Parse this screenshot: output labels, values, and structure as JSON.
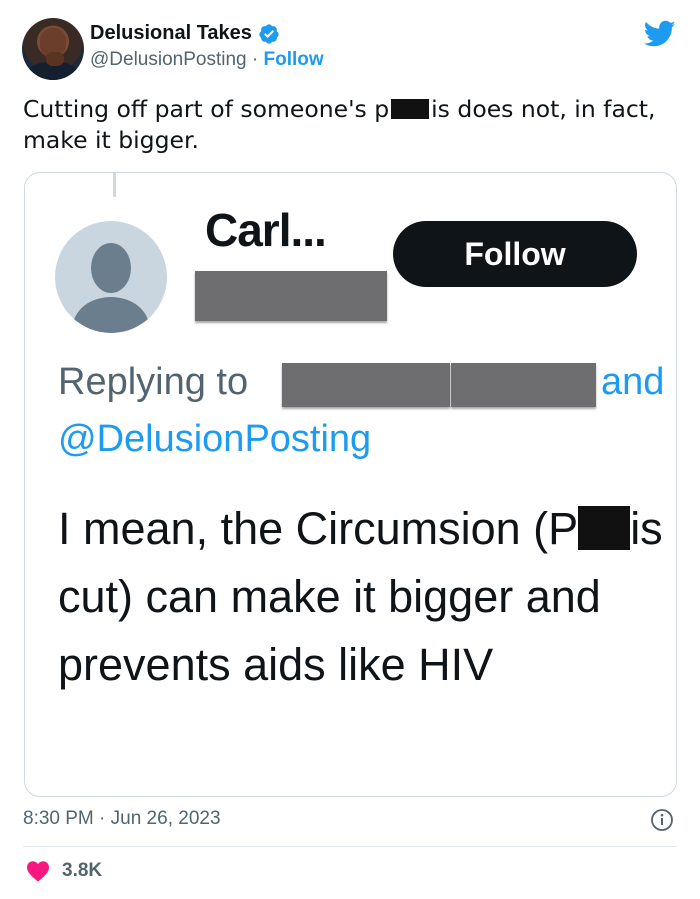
{
  "author": {
    "name": "Delusional Takes",
    "handle": "@DelusionPosting",
    "separator": " · ",
    "follow_label": "Follow"
  },
  "tweet": {
    "text_before": "Cutting off part of someone's p",
    "text_after": "is does not, in fact, make it bigger."
  },
  "embedded": {
    "name": "Carl...",
    "follow_label": "Follow",
    "replying_label": "Replying to",
    "and_label": "and",
    "mention": "@DelusionPosting",
    "reply_part1": "I mean, the Circumsion (P",
    "reply_part2": "is cut) can make it bigger and prevents aids like HIV"
  },
  "footer": {
    "timestamp": "8:30 PM · Jun 26, 2023",
    "likes": "3.8K"
  },
  "colors": {
    "accent": "#1d9bf0",
    "like": "#f91880",
    "text": "#0f1419",
    "muted": "#536471"
  },
  "icons": [
    "verified-badge-icon",
    "twitter-bird-icon",
    "info-icon",
    "heart-icon"
  ]
}
